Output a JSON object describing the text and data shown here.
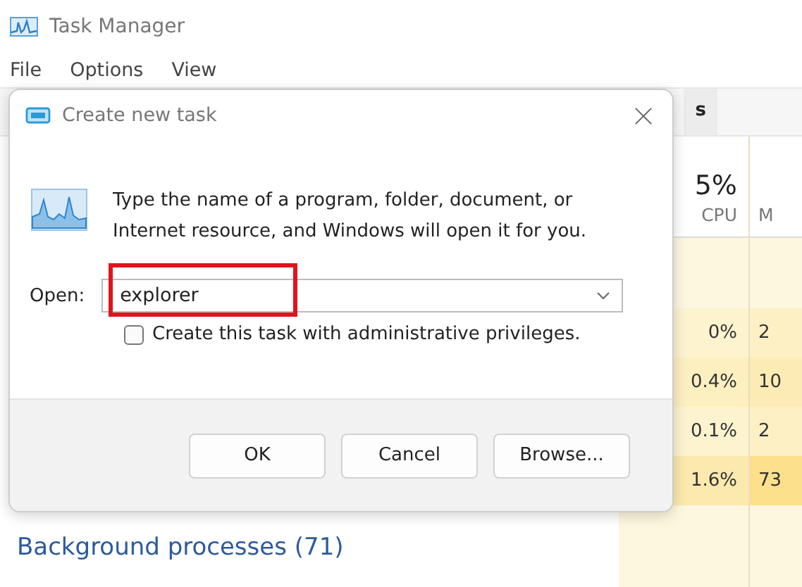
{
  "window": {
    "title": "Task Manager"
  },
  "menu": [
    "File",
    "Options",
    "View"
  ],
  "tabs": [
    {
      "label": "s",
      "selected": false
    }
  ],
  "columns": [
    {
      "summary": "5%",
      "label": "CPU"
    },
    {
      "label": "M"
    }
  ],
  "rows": [
    {
      "cpu": {
        "text": "0%",
        "color": "#fdf3cf"
      },
      "mem": {
        "text": "2",
        "color": "#fdf0c4"
      }
    },
    {
      "cpu": {
        "text": "0.4%",
        "color": "#fcefc0"
      },
      "mem": {
        "text": "10",
        "color": "#fcebb4"
      }
    },
    {
      "cpu": {
        "text": "0.1%",
        "color": "#fdf3cf"
      },
      "mem": {
        "text": "2",
        "color": "#fdf0c4"
      }
    },
    {
      "cpu": {
        "text": "1.6%",
        "color": "#fce9ad"
      },
      "mem": {
        "text": "73",
        "color": "#fde08c"
      }
    }
  ],
  "section": "Background processes (71)",
  "dialog": {
    "title": "Create new task",
    "message": "Type the name of a program, folder, document, or Internet resource, and Windows will open it for you.",
    "open_label": "Open:",
    "open_value": "explorer",
    "highlighted": true,
    "admin": {
      "label": "Create this task with administrative privileges.",
      "checked": false
    },
    "buttons": [
      "OK",
      "Cancel",
      "Browse..."
    ]
  }
}
